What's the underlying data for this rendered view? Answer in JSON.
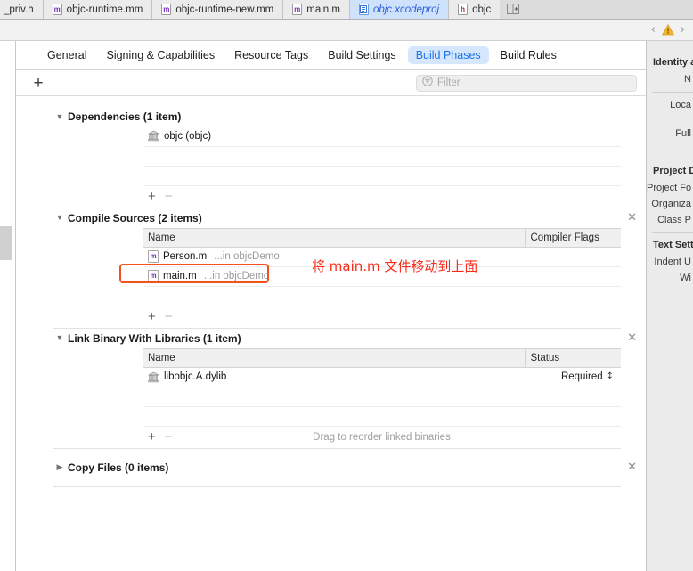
{
  "tabs": [
    {
      "label": "_priv.h",
      "icon": "",
      "kind": "none",
      "active": false,
      "clipped": true
    },
    {
      "label": "objc-runtime.mm",
      "icon": "m",
      "kind": "m",
      "active": false,
      "clipped": false
    },
    {
      "label": "objc-runtime-new.mm",
      "icon": "m",
      "kind": "m",
      "active": false,
      "clipped": false
    },
    {
      "label": "main.m",
      "icon": "m",
      "kind": "m",
      "active": false,
      "clipped": false
    },
    {
      "label": "objc.xcodeproj",
      "icon": "project-icon",
      "kind": "proj",
      "active": true,
      "clipped": false
    },
    {
      "label": "objc",
      "icon": "h",
      "kind": "h",
      "active": false,
      "clipped": true
    }
  ],
  "tabbar": {
    "add_tab_icon": "add-editor-icon"
  },
  "navbar": {
    "prev_icon": "chevron-left-icon",
    "next_icon": "chevron-right-icon",
    "warning_icon": "warning-triangle-icon",
    "warning_color": "#f0b429"
  },
  "segments": [
    {
      "label": "General",
      "active": false
    },
    {
      "label": "Signing & Capabilities",
      "active": false
    },
    {
      "label": "Resource Tags",
      "active": false
    },
    {
      "label": "Build Settings",
      "active": false
    },
    {
      "label": "Build Phases",
      "active": true
    },
    {
      "label": "Build Rules",
      "active": false
    }
  ],
  "toolbar": {
    "add_phase_label": "+",
    "filter_placeholder": "Filter",
    "filter_value": "",
    "filter_icon": "filter-icon"
  },
  "phases": [
    {
      "title": "Dependencies (1 item)",
      "expanded": true,
      "has_close": false,
      "has_header_row": false,
      "columns": [],
      "rows": [
        {
          "icon": "library-icon",
          "name": "objc (objc)",
          "path": "",
          "status": ""
        }
      ],
      "empty_rows": 2,
      "footer_hint": "",
      "add_label": "+",
      "remove_label": "−"
    },
    {
      "title": "Compile Sources (2 items)",
      "expanded": true,
      "has_close": true,
      "has_header_row": true,
      "columns": [
        "Name",
        "Compiler Flags"
      ],
      "rows": [
        {
          "icon": "objc-file-icon",
          "name": "Person.m",
          "path": "...in objcDemo",
          "status": ""
        },
        {
          "icon": "objc-file-icon",
          "name": "main.m",
          "path": "...in objcDemo",
          "status": "",
          "highlighted": true
        }
      ],
      "empty_rows": 1,
      "footer_hint": "",
      "add_label": "+",
      "remove_label": "−"
    },
    {
      "title": "Link Binary With Libraries (1 item)",
      "expanded": true,
      "has_close": true,
      "has_header_row": true,
      "columns": [
        "Name",
        "Status"
      ],
      "rows": [
        {
          "icon": "library-icon",
          "name": "libobjc.A.dylib",
          "path": "",
          "status": "Required"
        }
      ],
      "empty_rows": 2,
      "footer_hint": "Drag to reorder linked binaries",
      "add_label": "+",
      "remove_label": "−"
    },
    {
      "title": "Copy Files (0 items)",
      "expanded": false,
      "has_close": true,
      "has_header_row": false,
      "columns": [],
      "rows": [],
      "empty_rows": 0,
      "footer_hint": "",
      "add_label": "+",
      "remove_label": "−"
    }
  ],
  "annotation": {
    "text": "将 main.m 文件移动到上面",
    "color": "#f92a18",
    "ring_color": "#f4511e"
  },
  "inspector": {
    "groups": [
      {
        "title": "Identity an",
        "rows": [
          "N",
          "Loca",
          "Full"
        ]
      },
      {
        "title": "Project Do",
        "rows": [
          "Project Fo",
          "Organiza",
          "Class P"
        ]
      },
      {
        "title": "Text Settin",
        "rows": [
          "Indent U",
          "Wi"
        ]
      }
    ]
  }
}
